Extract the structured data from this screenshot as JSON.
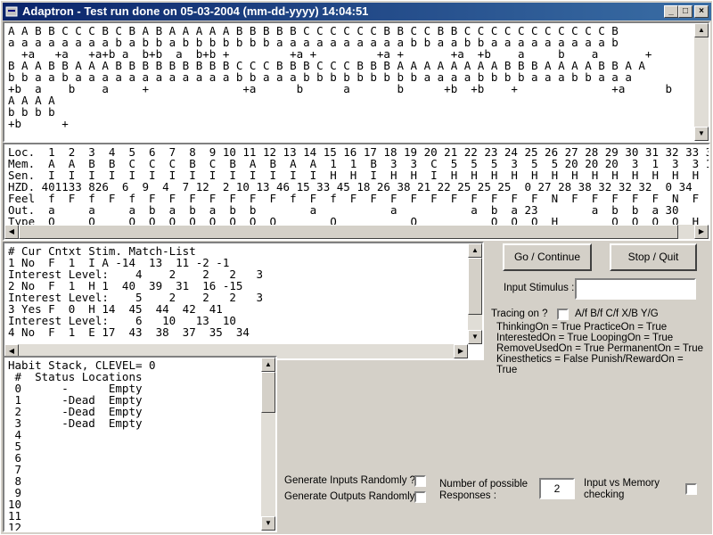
{
  "window": {
    "title": "Adaptron - Test run done on 05-03-2004 (mm-dd-yyyy) 14:04:51"
  },
  "titlebar_buttons": {
    "minimize": "_",
    "maximize": "□",
    "close": "×"
  },
  "sequence_panel": {
    "lines": [
      "A A B B C C C B C B A B A A A A A B B B B B C C C C C C B B C C B B C C C C C C C C C C C B",
      "a a a a a a a a b a b b a b b b b b b b a a a a a a a a a a b b a a b b a a a a a a a a a b",
      "  +a   +a   +a+b a  b+b  a  b+b +         +a +         +a +       +a  +b    a     b    a       +               +a      +b",
      "B A A B B A A A B B B B B B B B B C C C B B B C C C B B B A A A A A A A A B B B A A A A B B A A",
      "b b a a b a a a a a a a a a a a a b b a a a b b b b b b b b b a a a a b b b b a a a b b a a a",
      "+b  a    b    a     +              +a      b      a       b      +b  +b    +              +a      b      a       b",
      "A A A A",
      "b b b b",
      "+b      +"
    ]
  },
  "memory_table": {
    "lines": [
      "Loc.  1  2  3  4  5  6  7  8  9 10 11 12 13 14 15 16 17 18 19 20 21 22 23 24 25 26 27 28 29 30 31 32 33 34",
      "Mem.  A  A  B  B  C  C  C  B  C  B  A  B  A  A  1  1  B  3  3  C  5  5  5  3  5  5 20 20 20  3  1  3  3 17",
      "Sen.  I  I  I  I  I  I  I  I  I  I  I  I  I  I  H  H  I  H  H  I  H  H  H  H  H  H  H  H  H  H  H  H  H  H",
      "HZD. 401133 826  6  9  4  7 12  2 10 13 46 15 33 45 18 26 38 21 22 25 25 25  0 27 28 38 32 32 32  0 34",
      "Feel  f  F  f  F  f  F  F  F  F  F  F  F  f  F  f  F  F  F  F  F  F  F  F  F  F  N  F  F  F  F  F  N  F",
      "Out.  a     a     a  b  a  b  a  b  b        a           a           a  b  a 23        a  b  b  a 30",
      "Type  O     O     O  O  O  O  O  O  O  O        O           O           O  O  O  H        O  O  O  O  H"
    ]
  },
  "context_panel": {
    "lines": [
      "# Cur Cntxt Stim. Match-List",
      "1 No  F  1  I A -14  13  11 -2 -1",
      "Interest Level:    4    2    2   2   3",
      "2 No  F  1  H 1  40  39  31  16 -15",
      "Interest Level:    5    2    2   2   3",
      "3 Yes F  0  H 14  45  44  42  41",
      "Interest Level:    6   10   13  10",
      "4 No  F  1  E 17  43  38  37  35  34"
    ]
  },
  "habit_panel": {
    "lines": [
      "Habit Stack, CLEVEL= 0",
      " #  Status Locations",
      " 0      -      Empty",
      " 1      -Dead  Empty",
      " 2      -Dead  Empty",
      " 3      -Dead  Empty",
      " 4",
      " 5",
      " 6",
      " 7",
      " 8",
      " 9",
      "10",
      "11",
      "12"
    ]
  },
  "controls": {
    "go_button": "Go / Continue",
    "stop_button": "Stop / Quit",
    "input_stimulus_label": "Input Stimulus :",
    "input_stimulus_value": "",
    "tracing_label": "Tracing on ?",
    "tracing_options": "A/f  B/f  C/f  X/B  Y/G",
    "status_lines": [
      "ThinkingOn = True PracticeOn = True",
      "InterestedOn = True LoopingOn = True",
      "RemoveUsedOn = True PermanentOn = True",
      "Kinesthetics = False Punish/RewardOn =",
      "True"
    ],
    "gen_inputs_label": "Generate Inputs Randomly ?",
    "gen_outputs_label": "Generate Outputs Randomly?",
    "num_responses_label_1": "Number of possible",
    "num_responses_label_2": "Responses :",
    "num_responses_value": "2",
    "input_vs_memory_label_1": "Input vs Memory",
    "input_vs_memory_label_2": "checking"
  }
}
